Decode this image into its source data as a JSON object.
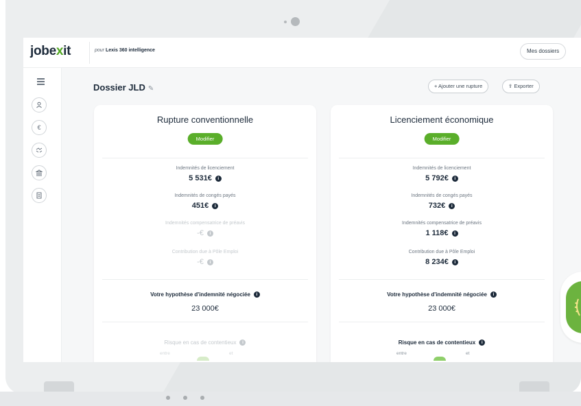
{
  "app": {
    "logo_text": "jobe",
    "logo_x": "x",
    "logo_tail": "it",
    "tagline_prefix": "pour",
    "tagline_brand": "Lexis 360 intelligence",
    "my_files": "Mes dossiers"
  },
  "dossier": {
    "title": "Dossier JLD",
    "add_label": "+ Ajouter une rupture",
    "export_label": "⇪ Exporter"
  },
  "sidebar": {
    "icons": [
      "user-icon",
      "euro-icon",
      "handshake-icon",
      "bank-icon",
      "document-icon"
    ]
  },
  "cards": [
    {
      "title": "Rupture conventionnelle",
      "modify": "Modifier",
      "rows": [
        {
          "label": "Indemnités de licenciement",
          "value": "5 531€",
          "dim": false
        },
        {
          "label": "Indemnités de congés payés",
          "value": "451€",
          "dim": false
        },
        {
          "label": "Indemnités compensatrice de préavis",
          "value": "-€",
          "dim": true
        },
        {
          "label": "Contribution due à Pôle Emploi",
          "value": "-€",
          "dim": true
        }
      ],
      "hypothesis_label": "Votre hypothèse d'indemnité négociée",
      "hypothesis_value": "23 000€",
      "risk_label": "Risque en cas de contentieux",
      "risk_dim": true,
      "risk_between": "entre",
      "risk_and": "et"
    },
    {
      "title": "Licenciement économique",
      "modify": "Modifier",
      "rows": [
        {
          "label": "Indemnités de licenciement",
          "value": "5 792€",
          "dim": false
        },
        {
          "label": "Indemnités de congés payés",
          "value": "732€",
          "dim": false
        },
        {
          "label": "Indemnités compensatrice de préavis",
          "value": "1 118€",
          "dim": false
        },
        {
          "label": "Contribution due à Pôle Emploi",
          "value": "8 234€",
          "dim": false
        }
      ],
      "hypothesis_label": "Votre hypothèse d'indemnité négociée",
      "hypothesis_value": "23 000€",
      "risk_label": "Risque en cas de contentieux",
      "risk_dim": false,
      "risk_between": "entre",
      "risk_and": "et"
    }
  ],
  "colors": {
    "accent_green": "#5aae2a",
    "dark_text": "#1c2a3a"
  }
}
